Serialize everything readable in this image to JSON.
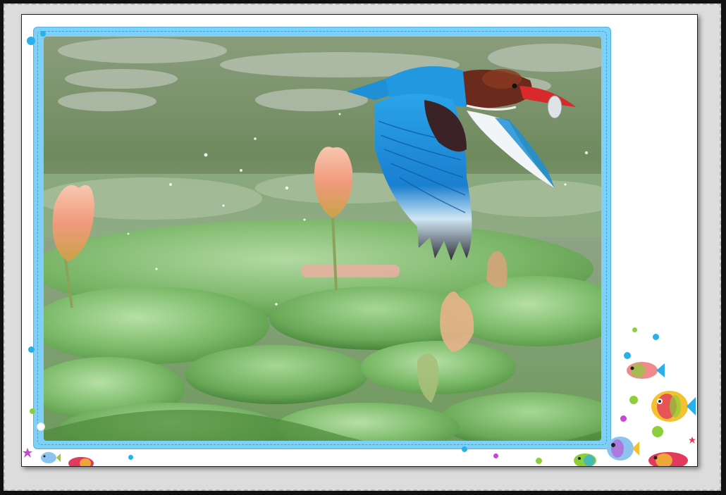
{
  "scene": {
    "subject": "kingfisher-with-fish",
    "background": "lily-pond",
    "colors": {
      "outer_frame": "#dcdcdc",
      "card": "#ffffff",
      "photo_border": "#7fd0f6",
      "water": "#6f8a5e",
      "lily_pad": "#7fbf6a",
      "bird_blue": "#1f8fd6",
      "bird_brown": "#6a2a1c",
      "beak_red": "#d82a2a",
      "lotus_pink": "#f2a07f"
    }
  },
  "decorations": {
    "fish_icons": [
      "fish-icon",
      "fish-icon",
      "fish-icon",
      "fish-icon",
      "fish-icon",
      "fish-icon"
    ],
    "bubble_colors": [
      "#2ab0e8",
      "#8ccf3a",
      "#c24ad0",
      "#f2c230",
      "#e23a5c"
    ]
  }
}
